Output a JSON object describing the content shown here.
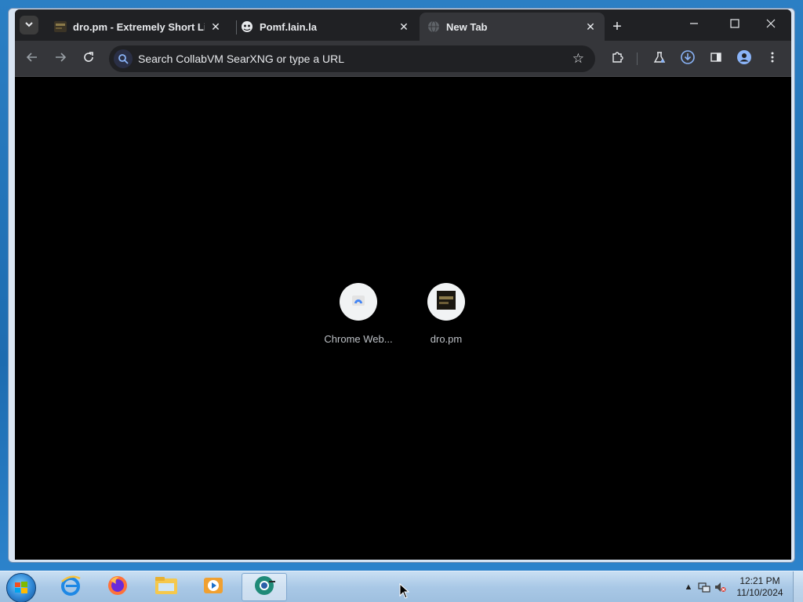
{
  "tabs": [
    {
      "title": "dro.pm - Extremely Short Links",
      "favicon": "dro-pm-favicon",
      "active": false
    },
    {
      "title": "Pomf.lain.la",
      "favicon": "pomf-favicon",
      "active": false
    },
    {
      "title": "New Tab",
      "favicon": "globe-icon",
      "active": true
    }
  ],
  "toolbar": {
    "omnibox_placeholder": "Search CollabVM SearXNG or type a URL"
  },
  "shortcuts": [
    {
      "label": "Chrome Web...",
      "icon": "chrome-web-store-icon"
    },
    {
      "label": "dro.pm",
      "icon": "dro-pm-icon"
    }
  ],
  "taskbar": {
    "apps": [
      "internet-explorer-icon",
      "firefox-icon",
      "file-explorer-icon",
      "media-player-icon",
      "chromium-browser-icon"
    ],
    "clock_time": "12:21 PM",
    "clock_date": "11/10/2024"
  },
  "colors": {
    "tab_strip": "#202124",
    "toolbar": "#35363a",
    "content_bg": "#000000",
    "taskbar": "#a9c8e6"
  }
}
